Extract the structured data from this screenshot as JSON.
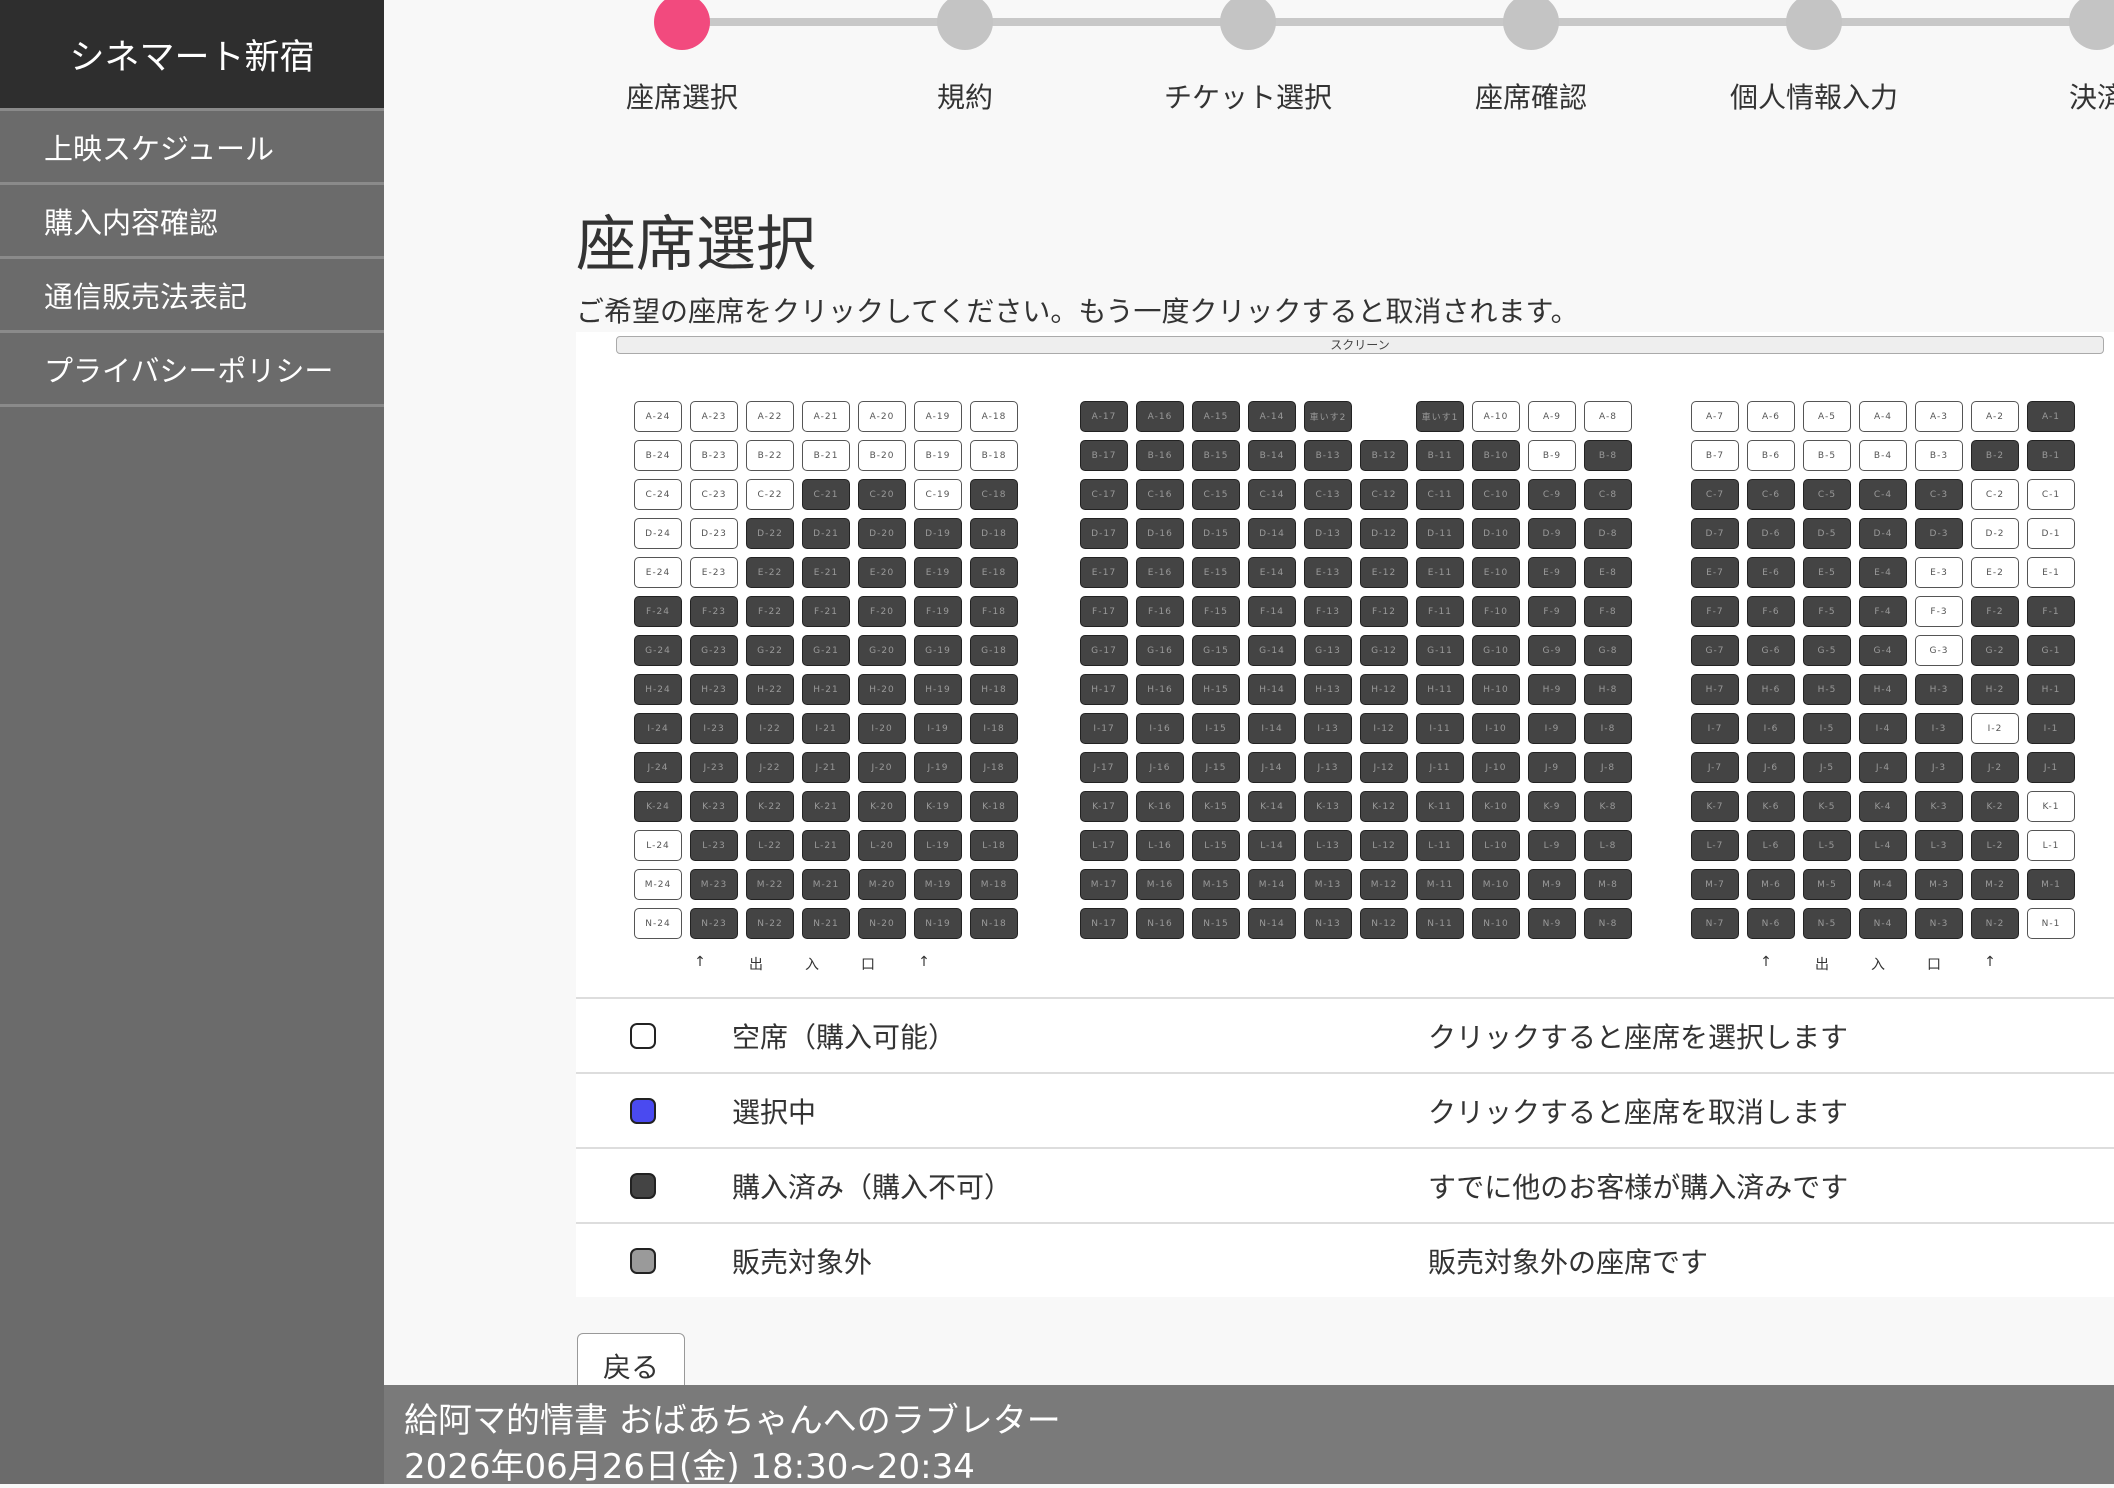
{
  "sidebar": {
    "brand": "シネマート新宿",
    "items": [
      {
        "label": "上映スケジュール"
      },
      {
        "label": "購入内容確認"
      },
      {
        "label": "通信販売法表記"
      },
      {
        "label": "プライバシーポリシー"
      }
    ]
  },
  "steps": [
    {
      "label": "座席選択",
      "active": true
    },
    {
      "label": "規約",
      "active": false
    },
    {
      "label": "チケット選択",
      "active": false
    },
    {
      "label": "座席確認",
      "active": false
    },
    {
      "label": "個人情報入力",
      "active": false
    },
    {
      "label": "決済",
      "active": false
    }
  ],
  "page": {
    "title": "座席選択",
    "instruction": "ご希望の座席をクリックしてください。もう一度クリックすると取消されます。"
  },
  "seatmap": {
    "screen_label": "スクリーン",
    "rows": [
      "A",
      "B",
      "C",
      "D",
      "E",
      "F",
      "G",
      "H",
      "I",
      "J",
      "K",
      "L",
      "M",
      "N"
    ],
    "blocks": [
      {
        "name": "left",
        "cols": [
          24,
          23,
          22,
          21,
          20,
          19,
          18
        ],
        "available": [
          "A-24",
          "A-23",
          "A-22",
          "A-21",
          "A-20",
          "A-19",
          "A-18",
          "B-24",
          "B-23",
          "B-22",
          "B-21",
          "B-20",
          "B-19",
          "B-18",
          "C-24",
          "C-23",
          "C-22",
          "C-19",
          "D-24",
          "D-23",
          "E-24",
          "E-23",
          "L-24",
          "M-24",
          "N-24"
        ]
      },
      {
        "name": "center",
        "cols": [
          17,
          16,
          15,
          14,
          13,
          12,
          11,
          10,
          9,
          8
        ],
        "available": [
          "A-10",
          "A-9",
          "A-8",
          "B-9"
        ],
        "gaps": [
          "A-12"
        ],
        "special_labels": {
          "A-13": "車いす2",
          "A-11": "車いす1"
        }
      },
      {
        "name": "right",
        "cols": [
          7,
          6,
          5,
          4,
          3,
          2,
          1
        ],
        "available": [
          "A-7",
          "A-6",
          "A-5",
          "A-4",
          "A-3",
          "A-2",
          "B-7",
          "B-6",
          "B-5",
          "B-4",
          "B-3",
          "C-2",
          "C-1",
          "D-2",
          "D-1",
          "E-3",
          "E-2",
          "E-1",
          "F-3",
          "G-3",
          "I-2",
          "K-1",
          "L-1",
          "N-1"
        ]
      }
    ],
    "exit_labels": [
      "↑",
      "出",
      "入",
      "口",
      "↑"
    ]
  },
  "legend": [
    {
      "name": "空席（購入可能）",
      "desc": "クリックすると座席を選択します",
      "swatch": "#ffffff"
    },
    {
      "name": "選択中",
      "desc": "クリックすると座席を取消します",
      "swatch": "#4a4af0"
    },
    {
      "name": "購入済み（購入不可）",
      "desc": "すでに他のお客様が購入済みです",
      "swatch": "#444444"
    },
    {
      "name": "販売対象外",
      "desc": "販売対象外の座席です",
      "swatch": "#9a9a9a"
    }
  ],
  "back_label": "戻る",
  "footer": {
    "movie_title": "給阿マ的情書 おばあちゃんへのラブレター",
    "showtime": "2026年06月26日(金) 18:30~20:34"
  }
}
